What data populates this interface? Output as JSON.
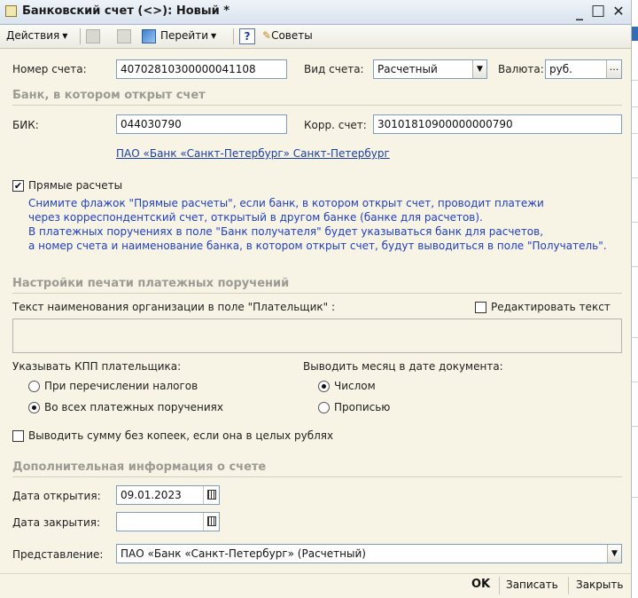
{
  "window": {
    "title": "Банковский счет (<>): Новый *",
    "minimize": "_",
    "maximize": "□",
    "close": "✕"
  },
  "toolbar": {
    "actions_label": "Действия",
    "goto_label": "Перейти",
    "help_label": "?",
    "tips_label": "Советы"
  },
  "account": {
    "number_label": "Номер счета:",
    "number_value": "40702810300000041108",
    "type_label": "Вид счета:",
    "type_value": "Расчетный",
    "currency_label": "Валюта:",
    "currency_value": "руб.",
    "currency_select": "..."
  },
  "bank_section": {
    "title": "Банк, в котором открыт счет",
    "bik_label": "БИК:",
    "bik_value": "044030790",
    "corr_label": "Корр. счет:",
    "corr_value": "30101810900000000790",
    "bank_link": "ПАО «Банк «Санкт-Петербург» Санкт-Петербург",
    "direct_label": "Прямые расчеты",
    "direct_checked": true,
    "hint_lines": [
      "Снимите флажок \"Прямые расчеты\", если банк, в котором открыт счет, проводит платежи",
      "через корреспондентский счет, открытый в другом банке (банке для расчетов).",
      "В платежных поручениях в поле \"Банк получателя\" будет указываться банк для расчетов,",
      "а номер счета и наименование банка, в котором открыт счет, будут выводиться в поле \"Получатель\"."
    ]
  },
  "print_section": {
    "title": "Настройки печати платежных поручений",
    "payer_text_label": "Текст наименования организации в поле \"Плательщик\" :",
    "edit_text_label": "Редактировать текст",
    "payer_text_value": "",
    "kpp_label": "Указывать КПП плательщика:",
    "kpp_options": [
      "При перечислении налогов",
      "Во всех платежных поручениях"
    ],
    "kpp_selected": 1,
    "month_label": "Выводить месяц в дате документа:",
    "month_options": [
      "Числом",
      "Прописью"
    ],
    "month_selected": 0,
    "no_kopecks_label": "Выводить сумму без копеек, если она в целых рублях"
  },
  "extra_section": {
    "title": "Дополнительная информация о счете",
    "open_date_label": "Дата открытия:",
    "open_date_value": "09.01.2023",
    "close_date_label": "Дата закрытия:",
    "close_date_value": " .  .",
    "presentation_label": "Представление:",
    "presentation_value": "ПАО «Банк «Санкт-Петербург» (Расчетный)"
  },
  "footer": {
    "ok_label": "OK",
    "save_label": "Записать",
    "close_label": "Закрыть"
  }
}
